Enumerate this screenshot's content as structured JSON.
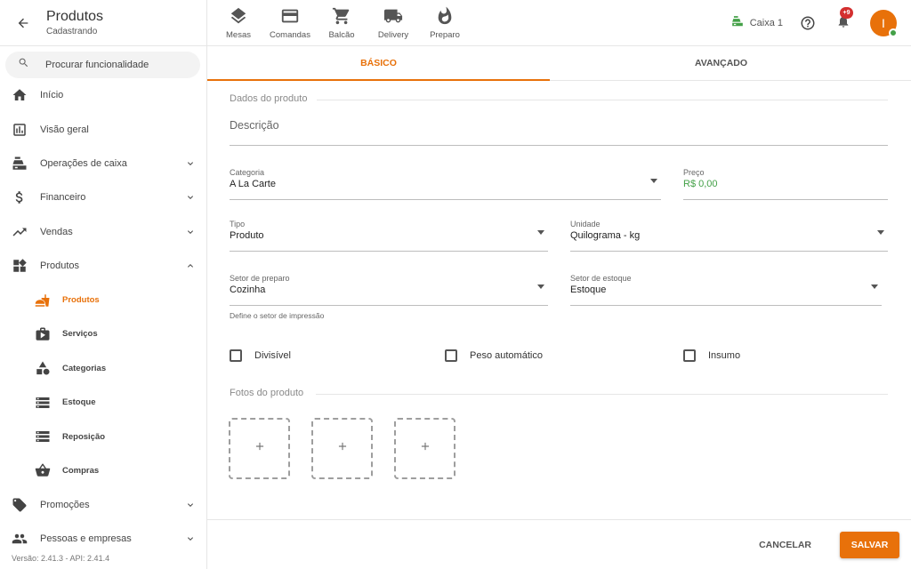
{
  "header": {
    "title": "Produtos",
    "subtitle": "Cadastrando"
  },
  "search": {
    "placeholder": "Procurar funcionalidade"
  },
  "sidebar": {
    "items": [
      {
        "label": "Início",
        "icon": "home-icon"
      },
      {
        "label": "Visão geral",
        "icon": "chart-icon"
      },
      {
        "label": "Operações de caixa",
        "icon": "cash-register-icon"
      },
      {
        "label": "Financeiro",
        "icon": "dollar-icon"
      },
      {
        "label": "Vendas",
        "icon": "trending-up-icon"
      },
      {
        "label": "Produtos",
        "icon": "widgets-icon"
      }
    ],
    "subitems": [
      {
        "label": "Produtos",
        "icon": "food-icon",
        "active": true
      },
      {
        "label": "Serviços",
        "icon": "briefcase-icon"
      },
      {
        "label": "Categorias",
        "icon": "shapes-icon"
      },
      {
        "label": "Estoque",
        "icon": "storage-icon"
      },
      {
        "label": "Reposição",
        "icon": "storage-icon"
      },
      {
        "label": "Compras",
        "icon": "basket-icon"
      }
    ],
    "bottom_items": [
      {
        "label": "Promoções",
        "icon": "tag-icon"
      },
      {
        "label": "Pessoas e empresas",
        "icon": "people-icon"
      }
    ],
    "version": "Versão: 2.41.3 - API: 2.41.4"
  },
  "topnav": [
    {
      "label": "Mesas",
      "icon": "layers-icon"
    },
    {
      "label": "Comandas",
      "icon": "card-icon"
    },
    {
      "label": "Balcão",
      "icon": "cart-icon"
    },
    {
      "label": "Delivery",
      "icon": "truck-icon"
    },
    {
      "label": "Preparo",
      "icon": "flame-icon"
    }
  ],
  "caixa": {
    "label": "Caixa 1",
    "color": "#43a047"
  },
  "notifications": {
    "badge": "+9"
  },
  "user": {
    "initial": "I",
    "color": "#e8710a"
  },
  "tabs": [
    {
      "label": "BÁSICO",
      "active": true
    },
    {
      "label": "AVANÇADO",
      "active": false
    }
  ],
  "form": {
    "section_product": "Dados do produto",
    "description_placeholder": "Descrição",
    "categoria": {
      "label": "Categoria",
      "value": "A La Carte"
    },
    "preco": {
      "label": "Preço",
      "value": "R$ 0,00"
    },
    "tipo": {
      "label": "Tipo",
      "value": "Produto"
    },
    "unidade": {
      "label": "Unidade",
      "value": "Quilograma - kg"
    },
    "setor_preparo": {
      "label": "Setor de preparo",
      "value": "Cozinha",
      "helper": "Define o setor de impressão"
    },
    "setor_estoque": {
      "label": "Setor de estoque",
      "value": "Estoque"
    },
    "checkboxes": [
      {
        "label": "Divisível",
        "checked": false
      },
      {
        "label": "Peso automático",
        "checked": false
      },
      {
        "label": "Insumo",
        "checked": false
      }
    ],
    "section_photos": "Fotos do produto",
    "photo_slots": 3
  },
  "footer": {
    "cancel": "CANCELAR",
    "save": "SALVAR"
  },
  "colors": {
    "accent": "#e8710a",
    "price": "#43a047",
    "badge": "#d32f2f"
  }
}
